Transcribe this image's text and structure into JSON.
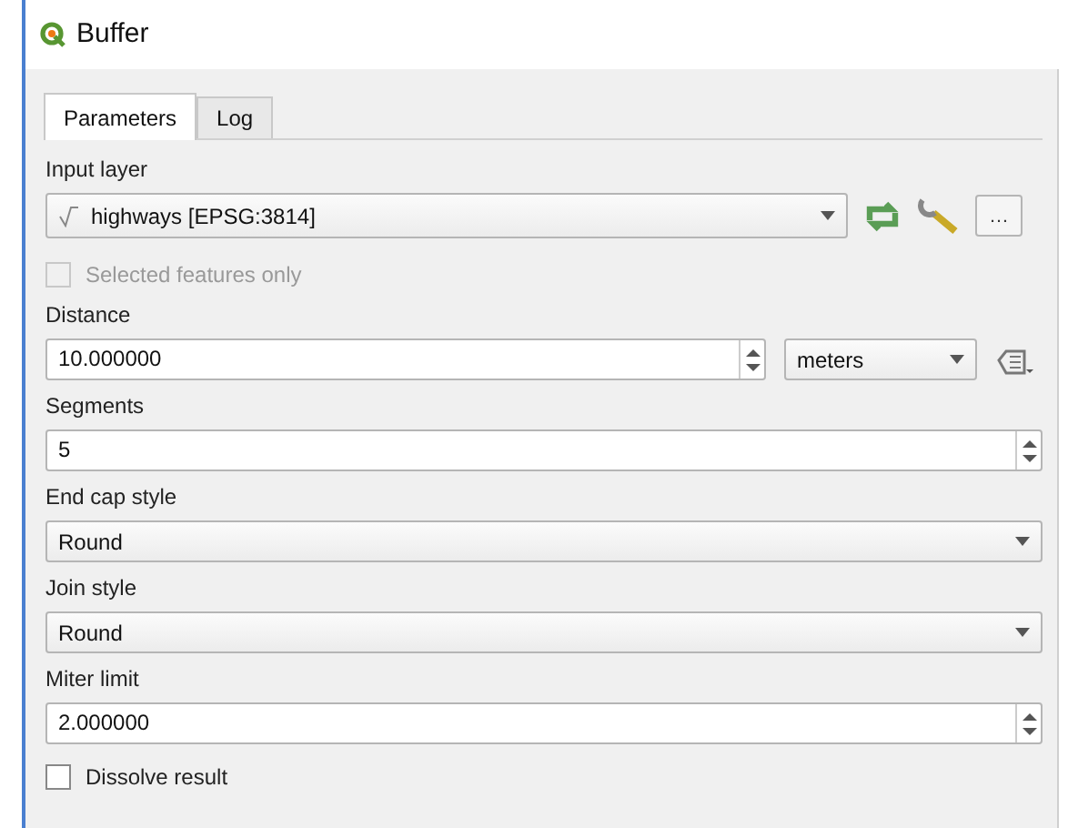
{
  "window": {
    "title": "Buffer"
  },
  "tabs": [
    {
      "label": "Parameters",
      "selected": true
    },
    {
      "label": "Log",
      "selected": false
    }
  ],
  "input_layer": {
    "label": "Input layer",
    "value": "highways [EPSG:3814]",
    "more_button": "…",
    "selected_only": {
      "label": "Selected features only",
      "checked": false,
      "disabled": true
    }
  },
  "distance": {
    "label": "Distance",
    "value": "10.000000",
    "unit": "meters"
  },
  "fields": [
    {
      "kind": "spin",
      "label": "Segments",
      "value": "5"
    },
    {
      "kind": "combo",
      "label": "End cap style",
      "value": "Round"
    },
    {
      "kind": "combo",
      "label": "Join style",
      "value": "Round"
    },
    {
      "kind": "spin",
      "label": "Miter limit",
      "value": "2.000000"
    },
    {
      "kind": "check",
      "label": "Dissolve result",
      "checked": false,
      "disabled": false
    }
  ]
}
